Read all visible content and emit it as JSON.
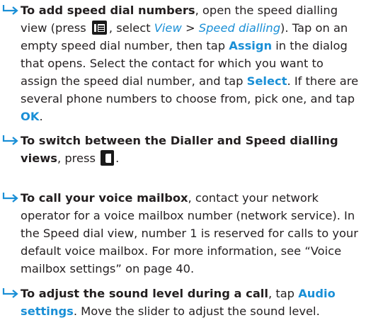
{
  "icons": {
    "tip_arrow": "arrow-icon",
    "menu_key": "menu-key-icon",
    "phone_key": "phone-key-icon"
  },
  "colors": {
    "text": "#231f20",
    "accent": "#1a8fd6"
  },
  "tips": [
    {
      "lead": "To add speed dial numbers",
      "t1": ", open the speed dialling view (press ",
      "t2": ", select ",
      "view": "View",
      "sep": " > ",
      "speed": "Speed dialling",
      "t3": "). Tap on an empty speed dial number, then tap ",
      "assign": "Assign",
      "t4": " in the dialog that opens. Select the contact for which you want to assign the speed dial number, and tap ",
      "select": "Select",
      "t5": ". If there are several phone numbers to choose from, pick one, and tap ",
      "ok": "OK",
      "t6": "."
    },
    {
      "lead": "To switch between the Dialler and Speed dialling views",
      "t1": ", press ",
      "t2": "."
    },
    {
      "lead": "To call your voice mailbox",
      "t1": ", contact your network operator for a voice mailbox number (network service). In the Speed dial view, number 1 is reserved for calls to your default voice mailbox. For more information, see “Voice mailbox settings” on page 40."
    },
    {
      "lead": "To adjust the sound level during a call",
      "t1": ", tap ",
      "audio": "Audio settings",
      "t2": ". Move the slider to adjust the sound level."
    }
  ]
}
